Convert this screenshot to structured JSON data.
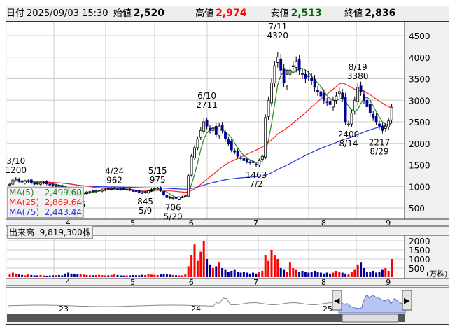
{
  "header": {
    "date_label": "日付",
    "datetime": "2025/09/03 15:30",
    "open_label": "始値",
    "open": "2,520",
    "high_label": "高値",
    "high": "2,974",
    "low_label": "安値",
    "low": "2,513",
    "close_label": "終値",
    "close": "2,836"
  },
  "colors": {
    "up": "#ff0000",
    "down": "#000099",
    "ma5": "#228822",
    "ma25": "#ff2222",
    "ma75": "#2233ee",
    "high": "#ff0000",
    "low": "#006600"
  },
  "ma_legend": [
    {
      "name": "MA(5)",
      "value": "2,499.60"
    },
    {
      "name": "MA(25)",
      "value": "2,869.64"
    },
    {
      "name": "MA(75)",
      "value": "2,443.44"
    }
  ],
  "volume_header": {
    "label": "出来高",
    "value": "9,819,300株"
  },
  "chart_data": {
    "type": "candlestick",
    "months": [
      {
        "label": "4",
        "start_index": 18
      },
      {
        "label": "5",
        "start_index": 39
      },
      {
        "label": "6",
        "start_index": 58
      },
      {
        "label": "7",
        "start_index": 79
      },
      {
        "label": "8",
        "start_index": 101
      },
      {
        "label": "9",
        "start_index": 122
      }
    ],
    "y_ticks": [
      500,
      1000,
      1500,
      2000,
      2500,
      3000,
      3500,
      4000,
      4500
    ],
    "ylim": [
      300,
      4700
    ],
    "vol_ticks": [
      500,
      1000,
      1500,
      2000
    ],
    "vol_unit": "(万株)",
    "closes": [
      1050,
      1150,
      1180,
      1120,
      1100,
      1120,
      1130,
      1080,
      1060,
      1070,
      1080,
      1090,
      1060,
      1040,
      1020,
      1030,
      1000,
      990,
      950,
      900,
      850,
      820,
      790,
      830,
      850,
      870,
      880,
      890,
      900,
      910,
      920,
      930,
      940,
      950,
      960,
      940,
      930,
      935,
      930,
      920,
      900,
      880,
      860,
      850,
      870,
      900,
      930,
      950,
      960,
      900,
      800,
      740,
      730,
      740,
      720,
      750,
      760,
      780,
      1250,
      1700,
      1900,
      2100,
      2300,
      2500,
      2400,
      2300,
      2350,
      2200,
      2400,
      2300,
      2100,
      2000,
      1850,
      1800,
      1700,
      1650,
      1600,
      1580,
      1560,
      1550,
      1500,
      1600,
      1700,
      2600,
      3000,
      3400,
      3800,
      4000,
      3700,
      3400,
      3600,
      3700,
      3800,
      3900,
      3700,
      3600,
      3500,
      3550,
      3450,
      3300,
      3200,
      3100,
      3000,
      2950,
      2900,
      3000,
      3100,
      3200,
      3050,
      2500,
      2450,
      2700,
      3000,
      3300,
      3200,
      3000,
      2850,
      2700,
      2600,
      2500,
      2400,
      2300,
      2400,
      2520,
      2836
    ],
    "volumes": [
      150,
      250,
      200,
      150,
      120,
      100,
      150,
      120,
      100,
      100,
      120,
      100,
      80,
      90,
      100,
      110,
      120,
      100,
      200,
      250,
      200,
      180,
      150,
      160,
      140,
      120,
      110,
      100,
      120,
      130,
      110,
      100,
      100,
      120,
      150,
      120,
      100,
      90,
      100,
      100,
      120,
      110,
      100,
      130,
      120,
      150,
      140,
      130,
      120,
      150,
      180,
      160,
      140,
      120,
      110,
      100,
      100,
      150,
      600,
      1200,
      1800,
      900,
      1400,
      2000,
      1000,
      700,
      500,
      600,
      800,
      500,
      400,
      300,
      350,
      400,
      300,
      250,
      300,
      250,
      200,
      250,
      200,
      300,
      350,
      1200,
      900,
      1500,
      1200,
      1000,
      500,
      400,
      300,
      800,
      500,
      400,
      300,
      350,
      300,
      250,
      300,
      350,
      300,
      250,
      200,
      250,
      200,
      250,
      350,
      300,
      250,
      200,
      150,
      300,
      400,
      700,
      800,
      500,
      300,
      300,
      350,
      250,
      300,
      400,
      500,
      350,
      1000
    ],
    "annotations": [
      {
        "date": "3/10",
        "value": "1200",
        "index": 2,
        "price": 1200,
        "pos": "above"
      },
      {
        "date": "4/9",
        "value": "775",
        "index": 22,
        "price": 775,
        "pos": "below"
      },
      {
        "date": "4/24",
        "value": "962",
        "index": 34,
        "price": 962,
        "pos": "above"
      },
      {
        "date": "5/9",
        "value": "845",
        "index": 44,
        "price": 845,
        "pos": "below"
      },
      {
        "date": "5/15",
        "value": "975",
        "index": 48,
        "price": 975,
        "pos": "above"
      },
      {
        "date": "5/20",
        "value": "706",
        "index": 53,
        "price": 706,
        "pos": "below"
      },
      {
        "date": "6/10",
        "value": "2711",
        "index": 64,
        "price": 2711,
        "pos": "above"
      },
      {
        "date": "7/2",
        "value": "1463",
        "index": 80,
        "price": 1463,
        "pos": "below"
      },
      {
        "date": "7/11",
        "value": "4320",
        "index": 87,
        "price": 4320,
        "pos": "above"
      },
      {
        "date": "8/14",
        "value": "2400",
        "index": 110,
        "price": 2400,
        "pos": "below"
      },
      {
        "date": "8/19",
        "value": "3380",
        "index": 113,
        "price": 3380,
        "pos": "above"
      },
      {
        "date": "8/29",
        "value": "2217",
        "index": 120,
        "price": 2217,
        "pos": "below"
      }
    ],
    "navigator": {
      "labels": [
        "23",
        "24",
        "25"
      ]
    }
  }
}
